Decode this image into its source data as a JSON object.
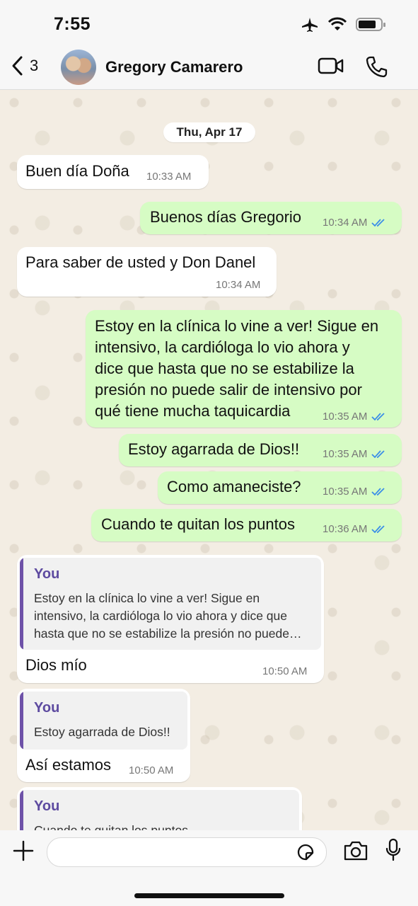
{
  "status_bar": {
    "time": "7:55"
  },
  "header": {
    "back_count": "3",
    "contact_name": "Gregory Camarero"
  },
  "date_separator": "Thu, Apr 17",
  "messages": [
    {
      "direction": "in",
      "text": "Buen día Doña",
      "time": "10:33 AM"
    },
    {
      "direction": "out",
      "text": "Buenos días Gregorio",
      "time": "10:34 AM",
      "read": true
    },
    {
      "direction": "in",
      "text": "Para saber de usted y Don Danel",
      "time": "10:34 AM"
    },
    {
      "direction": "out",
      "lines": [
        "Estoy en la clínica lo vine a ver! Sigue en",
        "intensivo, la cardióloga lo vio ahora y",
        "dice que hasta que no se estabilize la",
        "presión no puede salir de intensivo por",
        "qué tiene mucha taquicardia"
      ],
      "time": "10:35 AM",
      "read": true
    },
    {
      "direction": "out",
      "text": "Estoy agarrada de Dios!!",
      "time": "10:35 AM",
      "read": true
    },
    {
      "direction": "out",
      "text": "Como amaneciste?",
      "time": "10:35 AM",
      "read": true
    },
    {
      "direction": "out",
      "text": "Cuando te quitan los puntos",
      "time": "10:36 AM",
      "read": true
    },
    {
      "direction": "in",
      "quote_author": "You",
      "quote_lines": [
        "Estoy en la clínica lo vine a ver! Sigue en",
        "intensivo, la cardióloga lo vio ahora y dice que",
        "hasta que no se estabilize la presión no puede…"
      ],
      "text": "Dios mío",
      "time": "10:50 AM"
    },
    {
      "direction": "in",
      "quote_author": "You",
      "quote_lines": [
        "Estoy agarrada de Dios!!"
      ],
      "text": "Así estamos",
      "time": "10:50 AM"
    },
    {
      "direction": "in",
      "quote_author": "You",
      "quote_lines": [
        "Cuando te quitan los puntos"
      ]
    }
  ],
  "icons": {
    "back": "chevron-left-icon",
    "video": "video-camera-icon",
    "call": "phone-icon",
    "plus": "plus-icon",
    "sticker": "sticker-icon",
    "camera": "camera-icon",
    "mic": "microphone-icon"
  },
  "colors": {
    "outgoing_bubble": "#d6fcc4",
    "incoming_bubble": "#ffffff",
    "read_ticks": "#3b8ee8",
    "quote_author": "#5d4aa0"
  }
}
